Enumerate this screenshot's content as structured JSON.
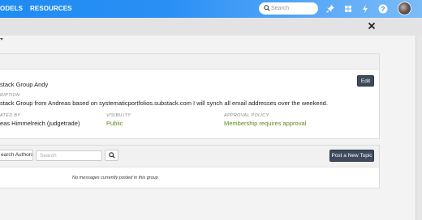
{
  "nav": {
    "links": [
      "ODELS",
      "RESOURCES"
    ],
    "search_placeholder": "Search"
  },
  "group": {
    "name_label": "",
    "name_value": "stack Group Andy",
    "edit_label": "Edit",
    "description_label": "RIPTION",
    "description_value": "stack Group from Andreas based on systematicportfolios.substack.com I will synch all email addresses over the weekend.",
    "created_by_label": "ATED BY",
    "created_by_value": "eas Himmelreich (judgetrade)",
    "visibility_label": "VISIBILITY",
    "visibility_value": "Public",
    "approval_label": "APPROVAL POLICY",
    "approval_value": "Membership requires approval"
  },
  "topics": {
    "authors_label": "earch Authors",
    "search_placeholder": "Search",
    "new_topic_label": "Post a New Topic",
    "empty_message": "No messages currently posted in this group"
  },
  "colors": {
    "nav_start": "#1e8cf2",
    "nav_end": "#7bbcf9",
    "button_dark": "#3f4a5c",
    "green_text": "#5a8a1a"
  }
}
